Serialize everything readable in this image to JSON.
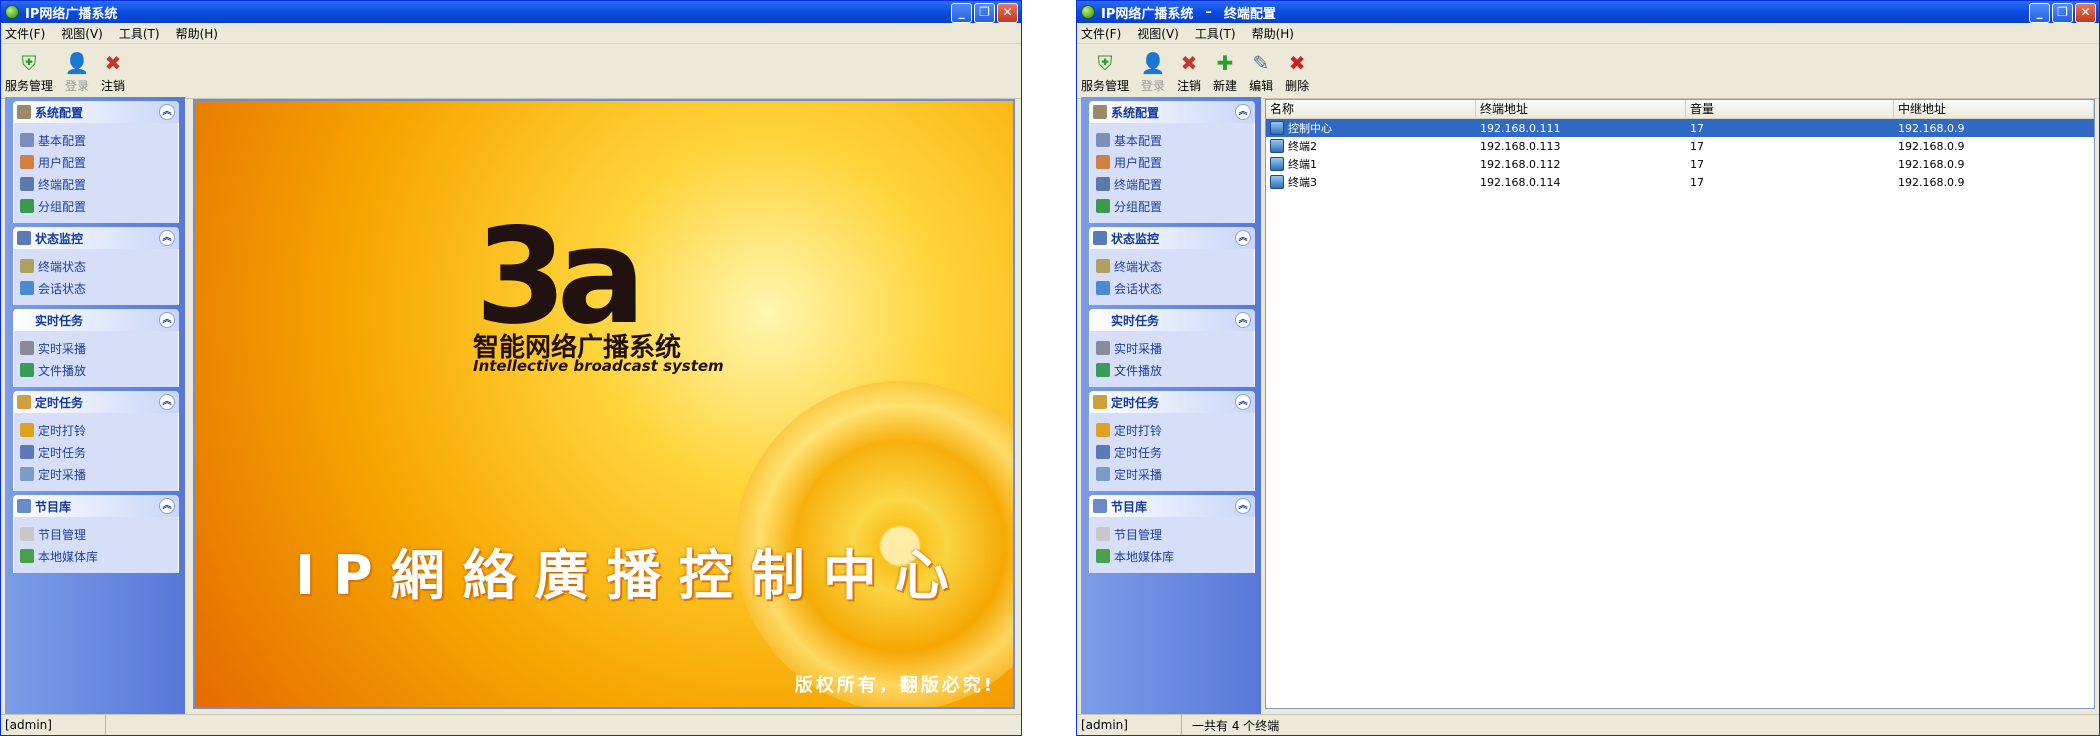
{
  "window1": {
    "title": "IP网络广播系统",
    "menu": [
      "文件(F)",
      "视图(V)",
      "工具(T)",
      "帮助(H)"
    ],
    "toolbar": [
      {
        "label": "服务管理",
        "icon": "shield-icon",
        "enabled": true
      },
      {
        "label": "登录",
        "icon": "user-icon",
        "enabled": false
      },
      {
        "label": "注销",
        "icon": "logout-icon",
        "enabled": true
      }
    ],
    "sidebar": [
      {
        "title": "系统配置",
        "icon": "tools-icon",
        "items": [
          "基本配置",
          "用户配置",
          "终端配置",
          "分组配置"
        ]
      },
      {
        "title": "状态监控",
        "icon": "monitor-icon",
        "items": [
          "终端状态",
          "会话状态"
        ]
      },
      {
        "title": "实时任务",
        "icon": "",
        "items": [
          "实时采播",
          "文件播放"
        ]
      },
      {
        "title": "定时任务",
        "icon": "clock-icon",
        "items": [
          "定时打铃",
          "定时任务",
          "定时采播"
        ]
      },
      {
        "title": "节目库",
        "icon": "library-icon",
        "items": [
          "节目管理",
          "本地媒体库"
        ]
      }
    ],
    "splash": {
      "logo": "3a",
      "product_cn": "智能网络广播系统",
      "product_en": "Intellective broadcast system",
      "slogan": "IP網絡廣播控制中心",
      "copyright": "版权所有，翻版必究!"
    },
    "status": {
      "user": "[admin]"
    }
  },
  "window2": {
    "title": "IP网络广播系统",
    "subtitle": "终端配置",
    "separator": "–",
    "menu": [
      "文件(F)",
      "视图(V)",
      "工具(T)",
      "帮助(H)"
    ],
    "toolbar": [
      {
        "label": "服务管理",
        "icon": "shield-icon",
        "enabled": true
      },
      {
        "label": "登录",
        "icon": "user-icon",
        "enabled": false
      },
      {
        "label": "注销",
        "icon": "logout-icon",
        "enabled": true
      },
      {
        "label": "新建",
        "icon": "plus-icon",
        "enabled": true
      },
      {
        "label": "编辑",
        "icon": "edit-icon",
        "enabled": true
      },
      {
        "label": "删除",
        "icon": "delete-icon",
        "enabled": true
      }
    ],
    "sidebar": [
      {
        "title": "系统配置",
        "icon": "tools-icon",
        "items": [
          "基本配置",
          "用户配置",
          "终端配置",
          "分组配置"
        ]
      },
      {
        "title": "状态监控",
        "icon": "monitor-icon",
        "items": [
          "终端状态",
          "会话状态"
        ]
      },
      {
        "title": "实时任务",
        "icon": "",
        "items": [
          "实时采播",
          "文件播放"
        ]
      },
      {
        "title": "定时任务",
        "icon": "clock-icon",
        "items": [
          "定时打铃",
          "定时任务",
          "定时采播"
        ]
      },
      {
        "title": "节目库",
        "icon": "library-icon",
        "items": [
          "节目管理",
          "本地媒体库"
        ]
      }
    ],
    "table": {
      "columns": [
        "名称",
        "终端地址",
        "音量",
        "中继地址"
      ],
      "rows": [
        {
          "name": "控制中心",
          "addr": "192.168.0.111",
          "volume": "17",
          "relay": "192.168.0.9",
          "selected": true
        },
        {
          "name": "终端2",
          "addr": "192.168.0.113",
          "volume": "17",
          "relay": "192.168.0.9",
          "selected": false
        },
        {
          "name": "终端1",
          "addr": "192.168.0.112",
          "volume": "17",
          "relay": "192.168.0.9",
          "selected": false
        },
        {
          "name": "终端3",
          "addr": "192.168.0.114",
          "volume": "17",
          "relay": "192.168.0.9",
          "selected": false
        }
      ]
    },
    "status": {
      "user": "[admin]",
      "message": "一共有 4 个终端"
    }
  },
  "colors": {
    "titlebar": "#0a4de0",
    "sidebar": "#5878d8",
    "selection": "#316ac5",
    "splash": "#f7a500"
  }
}
